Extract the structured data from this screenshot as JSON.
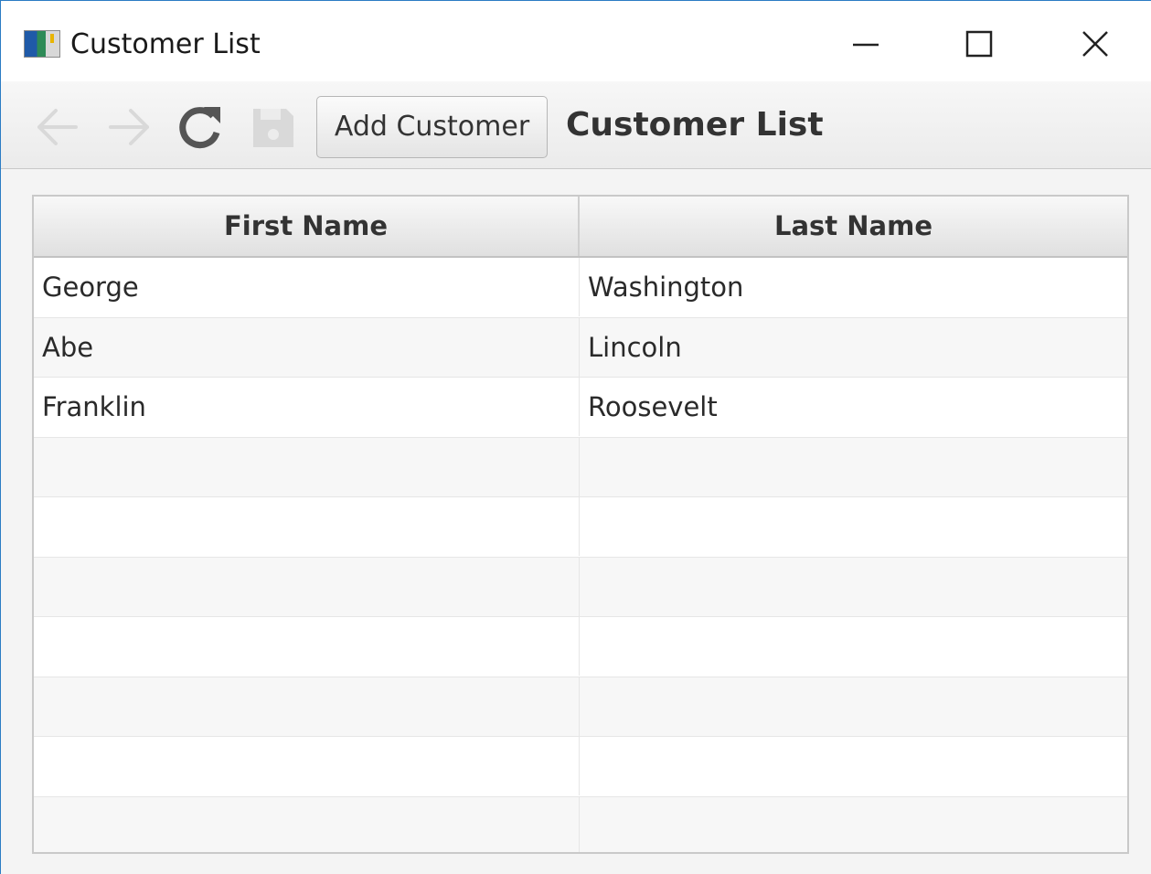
{
  "window": {
    "title": "Customer List",
    "controls": {
      "minimize_icon": "minimize-icon",
      "maximize_icon": "maximize-icon",
      "close_icon": "close-icon"
    }
  },
  "toolbar": {
    "back_icon": "arrow-left-icon",
    "forward_icon": "arrow-right-icon",
    "refresh_icon": "refresh-icon",
    "save_icon": "save-icon",
    "add_customer_label": "Add Customer",
    "title": "Customer List"
  },
  "table": {
    "columns": [
      "First Name",
      "Last Name"
    ],
    "rows": [
      {
        "first": "George",
        "last": "Washington"
      },
      {
        "first": "Abe",
        "last": "Lincoln"
      },
      {
        "first": "Franklin",
        "last": "Roosevelt"
      },
      {
        "first": "",
        "last": ""
      },
      {
        "first": "",
        "last": ""
      },
      {
        "first": "",
        "last": ""
      },
      {
        "first": "",
        "last": ""
      },
      {
        "first": "",
        "last": ""
      },
      {
        "first": "",
        "last": ""
      },
      {
        "first": "",
        "last": ""
      }
    ]
  },
  "colors": {
    "window_border": "#2b7cc4",
    "toolbar_bg": "#efefef",
    "disabled_icon": "#d6d6d6",
    "enabled_icon": "#555555"
  }
}
